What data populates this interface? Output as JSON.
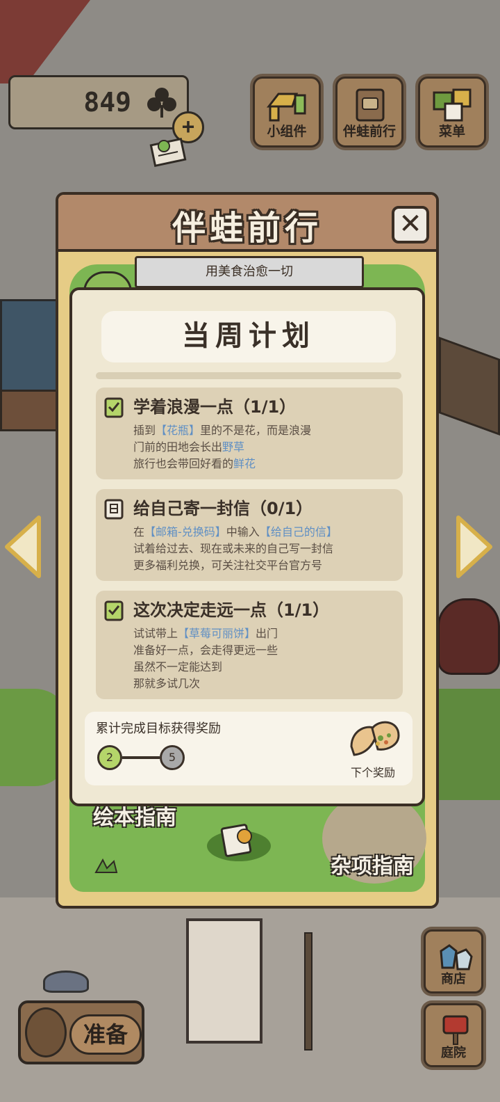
{
  "hud": {
    "coins": "849",
    "buttons": [
      {
        "label": "小组件",
        "icon": "widget-icon"
      },
      {
        "label": "伴蛙前行",
        "icon": "journey-book-icon"
      },
      {
        "label": "菜单",
        "icon": "menu-cards-icon"
      }
    ]
  },
  "panel": {
    "title": "伴蛙前行",
    "ribbon": "用美食治愈一切",
    "guide_left": "绘本指南",
    "guide_right": "杂项指南"
  },
  "plan": {
    "title": "当周计划",
    "tasks": [
      {
        "status": "done",
        "title": "学着浪漫一点（1/1）",
        "lines": [
          {
            "pre": "插到",
            "hl": "【花瓶】",
            "post": "里的不是花，而是浪漫"
          },
          {
            "pre": "门前的田地会长出",
            "hl": "野草",
            "post": ""
          },
          {
            "pre": "旅行也会带回好看的",
            "hl": "鲜花",
            "post": ""
          }
        ]
      },
      {
        "status": "pending",
        "title": "给自己寄一封信（0/1）",
        "lines": [
          {
            "pre": "在",
            "hl": "【邮箱-兑换码】",
            "post": "中输入",
            "hl2": "【给自己的信】"
          },
          {
            "pre": "试着给过去、现在或未来的自己写一封信",
            "hl": "",
            "post": ""
          },
          {
            "pre": "更多福利兑换，可关注社交平台官方号",
            "hl": "",
            "post": ""
          }
        ]
      },
      {
        "status": "done",
        "title": "这次决定走远一点（1/1）",
        "lines": [
          {
            "pre": "试试带上",
            "hl": "【草莓可丽饼】",
            "post": "出门"
          },
          {
            "pre": "准备好一点，会走得更远一些",
            "hl": "",
            "post": ""
          },
          {
            "pre": "虽然不一定能达到",
            "hl": "",
            "post": ""
          },
          {
            "pre": "那就多试几次",
            "hl": "",
            "post": ""
          }
        ]
      }
    ],
    "reward": {
      "label": "累计完成目标获得奖励",
      "current": "2",
      "total": "5",
      "next_label": "下个奖励"
    }
  },
  "bottom": {
    "prepare": "准备",
    "shop": "商店",
    "yard": "庭院"
  },
  "colors": {
    "panel_bg": "#e6cc86",
    "header_bg": "#b2896a",
    "card_bg": "#efe8d3",
    "task_bg": "#ddd1b6",
    "highlight": "#5f8fc4",
    "green": "#7db653"
  }
}
